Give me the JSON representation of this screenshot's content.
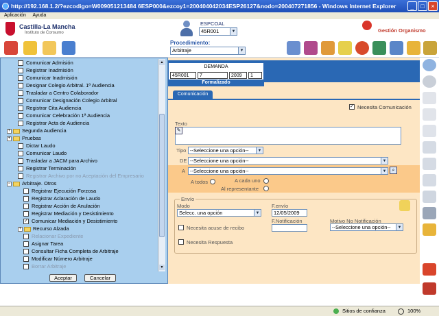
{
  "window": {
    "title": "http://192.168.1.2/?ezcodigo=W009051213484 6ESP000&ezcoy1=200404042034ESP26127&nodo=200407271856 - Windows Internet Explorer",
    "menu": [
      "Aplicación",
      "Ayuda"
    ]
  },
  "header": {
    "org_name": "Castilla-La Mancha",
    "org_subtitle": "Instituto de Consumo",
    "espcoal_label": "ESPCOAL",
    "espcoal_value": "45R001",
    "gestion_label": "Gestión Organismo"
  },
  "procedimiento": {
    "label": "Procedimiento:",
    "value": "Arbitraje"
  },
  "tree": {
    "items": [
      {
        "label": "Comunicar Admisión",
        "indent": 1,
        "kind": "check"
      },
      {
        "label": "Registrar Inadmisión",
        "indent": 1,
        "kind": "check"
      },
      {
        "label": "Comunicar Inadmisión",
        "indent": 1,
        "kind": "check"
      },
      {
        "label": "Designar Colegio Arbitral. 1ª Audiencia",
        "indent": 1,
        "kind": "check"
      },
      {
        "label": "Trasladar a Centro Colaborador",
        "indent": 1,
        "kind": "check"
      },
      {
        "label": "Comunicar Designación Colegio Arbitral",
        "indent": 1,
        "kind": "check"
      },
      {
        "label": "Registrar Cita Audiencia",
        "indent": 1,
        "kind": "check"
      },
      {
        "label": "Comunicar Celebración 1ª Audiencia",
        "indent": 1,
        "kind": "check"
      },
      {
        "label": "Registrar Acta de Audiencia",
        "indent": 1,
        "kind": "check"
      },
      {
        "label": "Segunda Audiencia",
        "indent": 0,
        "kind": "folder"
      },
      {
        "label": "Pruebas",
        "indent": 0,
        "kind": "folder"
      },
      {
        "label": "Dictar Laudo",
        "indent": 1,
        "kind": "check"
      },
      {
        "label": "Comunicar Laudo",
        "indent": 1,
        "kind": "check"
      },
      {
        "label": "Trasladar a JACM para Archivo",
        "indent": 1,
        "kind": "check"
      },
      {
        "label": "Registrar Terminación",
        "indent": 1,
        "kind": "check"
      },
      {
        "label": "Registrar Archivo por no Aceptación del Empresario",
        "indent": 1,
        "kind": "check",
        "disabled": true
      },
      {
        "label": "Arbitraje. Otros",
        "indent": 0,
        "kind": "folder-open"
      },
      {
        "label": "Registrar Ejecución Forzosa",
        "indent": 2,
        "kind": "check"
      },
      {
        "label": "Registrar Aclaración de Laudo",
        "indent": 2,
        "kind": "check"
      },
      {
        "label": "Registrar Acción de Anulación",
        "indent": 2,
        "kind": "check"
      },
      {
        "label": "Registrar Mediación y Desistimiento",
        "indent": 2,
        "kind": "check"
      },
      {
        "label": "Comunicar Mediación y Desistimiento",
        "indent": 2,
        "kind": "check",
        "checked": true
      },
      {
        "label": "Recurso Alzada",
        "indent": 1,
        "kind": "folder"
      },
      {
        "label": "Relacionar Expediente",
        "indent": 2,
        "kind": "check",
        "disabled": true
      },
      {
        "label": "Asignar Tarea",
        "indent": 2,
        "kind": "check"
      },
      {
        "label": "Consultar Ficha Completa de Arbitraje",
        "indent": 2,
        "kind": "check"
      },
      {
        "label": "Modificar Número Arbitraje",
        "indent": 2,
        "kind": "check"
      },
      {
        "label": "Borrar Arbitraje",
        "indent": 2,
        "kind": "check",
        "disabled": true
      }
    ],
    "accept_label": "Aceptar",
    "cancel_label": "Cancelar"
  },
  "demanda": {
    "title": "DEMANDA",
    "cells": [
      "45R001",
      "7",
      "2009",
      "1"
    ],
    "status": "Formalizado"
  },
  "form": {
    "tab_label": "Comunicación",
    "necesita_comunicacion": "Necesita Comunicación",
    "texto_label": "Texto",
    "tipo_label": "Tipo",
    "tipo_value": "--Seleccione una opción--",
    "de_label": "DE",
    "de_value": "--Seleccione una opción--",
    "a_label": "A",
    "a_value": "--Seleccione una opción--",
    "a_todos": "A todos",
    "a_cada_uno": "A cada uno",
    "al_representante": "Al representante",
    "envio_legend": "Envío",
    "modo_label": "Modo",
    "modo_value": "Selecc. una opción",
    "fenvio_label": "F.envío",
    "fenvio_value": "12/05/2009",
    "fnotif_label": "F.Notificación",
    "motivo_label": "Motivo No Notificación",
    "motivo_value": "--Seleccione una opción--",
    "acuse_label": "Necesita acuse de recibo",
    "respuesta_label": "Necesita Respuesta"
  },
  "statusbar": {
    "zone": "Sitios de confianza",
    "zoom": "100%"
  }
}
